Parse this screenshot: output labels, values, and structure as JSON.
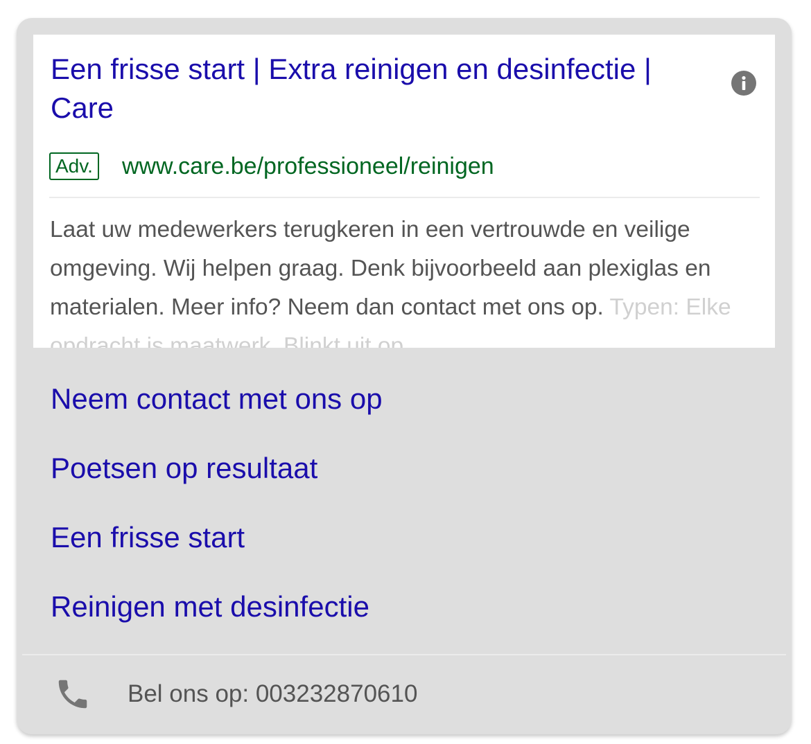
{
  "ad": {
    "title": "Een frisse start | Extra reinigen en desinfectie | Care",
    "badge": "Adv.",
    "display_url": "www.care.be/professioneel/reinigen",
    "description": "Laat uw medewerkers terugkeren in een vertrouwde en veilige omgeving. Wij helpen graag. Denk bijvoorbeeld aan plexiglas en materialen. Meer info? Neem dan contact met ons op.",
    "description_faded": "Typen: Elke opdracht is maatwerk, Blinkt uit op…",
    "info_icon": "info-icon"
  },
  "sitelinks": [
    "Neem contact met ons op",
    "Poetsen op resultaat",
    "Een frisse start",
    "Reinigen met desinfectie"
  ],
  "call": {
    "icon": "phone-icon",
    "text": "Bel ons op: 003232870610"
  },
  "colors": {
    "title_link": "#1a0dab",
    "url_green": "#006621",
    "body_text": "#545454",
    "card_background": "#dedede"
  }
}
